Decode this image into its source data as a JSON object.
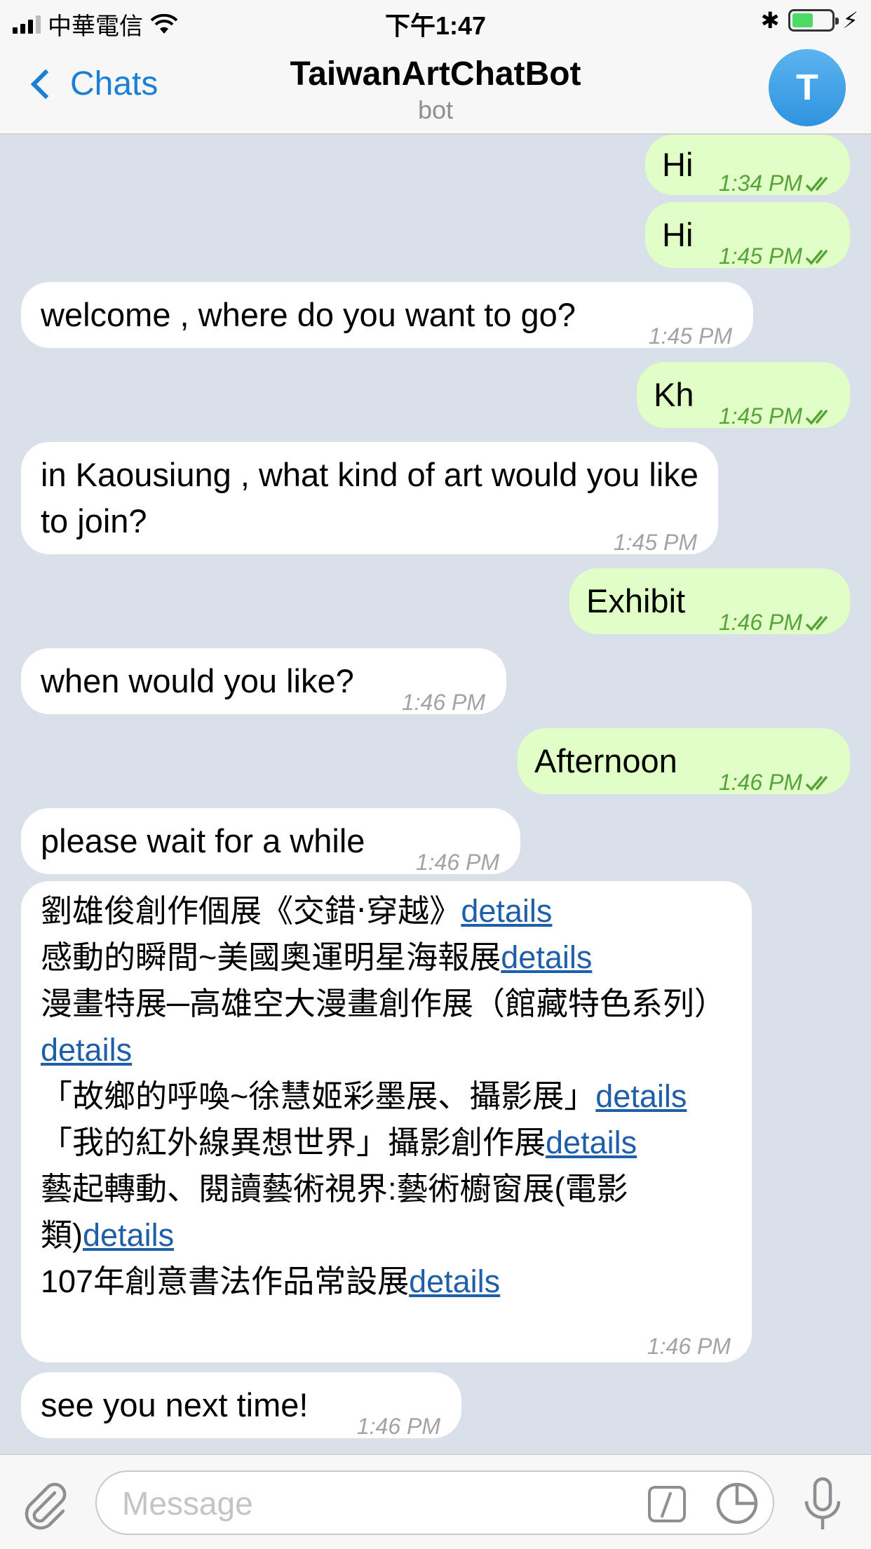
{
  "status_bar": {
    "carrier": "中華電信",
    "time": "下午1:47",
    "bluetooth": "✱",
    "battery_level": 0.55,
    "charging": "⚡"
  },
  "nav": {
    "back_label": "Chats",
    "title": "TaiwanArtChatBot",
    "subtitle": "bot",
    "avatar_letter": "T"
  },
  "messages": [
    {
      "dir": "out",
      "text": "Hi",
      "time": "1:34 PM"
    },
    {
      "dir": "out",
      "text": "Hi",
      "time": "1:45 PM"
    },
    {
      "dir": "in",
      "text": "welcome , where do you want to go?",
      "time": "1:45 PM"
    },
    {
      "dir": "out",
      "text": "Kh",
      "time": "1:45 PM"
    },
    {
      "dir": "in",
      "text": "in Kaousiung , what kind of art would you like to join?",
      "time": "1:45 PM"
    },
    {
      "dir": "out",
      "text": "Exhibit",
      "time": "1:46 PM"
    },
    {
      "dir": "in",
      "text": "when would you like?",
      "time": "1:46 PM"
    },
    {
      "dir": "out",
      "text": "Afternoon",
      "time": "1:46 PM"
    },
    {
      "dir": "in",
      "text": "please wait for a while",
      "time": "1:46 PM"
    },
    {
      "dir": "in",
      "time": "1:46 PM",
      "lines": [
        {
          "text": "劉雄俊創作個展《交錯‧穿越》",
          "link": "details"
        },
        {
          "text": "感動的瞬間~美國奧運明星海報展",
          "link": "details"
        },
        {
          "text": "漫畫特展─高雄空大漫畫創作展（館藏特色系列）",
          "link": "details"
        },
        {
          "text": "「故鄉的呼喚~徐慧姬彩墨展、攝影展」",
          "link": "details"
        },
        {
          "text": "「我的紅外線異想世界」攝影創作展",
          "link": "details"
        },
        {
          "text": "藝起轉動、閱讀藝術視界:藝術櫥窗展(電影類)",
          "link": "details"
        },
        {
          "text": "107年創意書法作品常設展",
          "link": "details"
        }
      ]
    },
    {
      "dir": "in",
      "text": "see you next time!",
      "time": "1:46 PM"
    }
  ],
  "input": {
    "placeholder": "Message",
    "value": ""
  },
  "icons": [
    "attach-icon",
    "bot-command-icon",
    "sticker-icon",
    "microphone-icon",
    "back-chevron-icon",
    "wifi-icon",
    "bluetooth-icon",
    "battery-icon",
    "read-ticks-icon"
  ],
  "colors": {
    "accent": "#1c7fd6",
    "outgoing_bubble": "#e1fec6",
    "incoming_bubble": "#ffffff",
    "chat_background": "#d9e0e9",
    "link": "#1f5fa8",
    "outgoing_time": "#55a33a"
  }
}
